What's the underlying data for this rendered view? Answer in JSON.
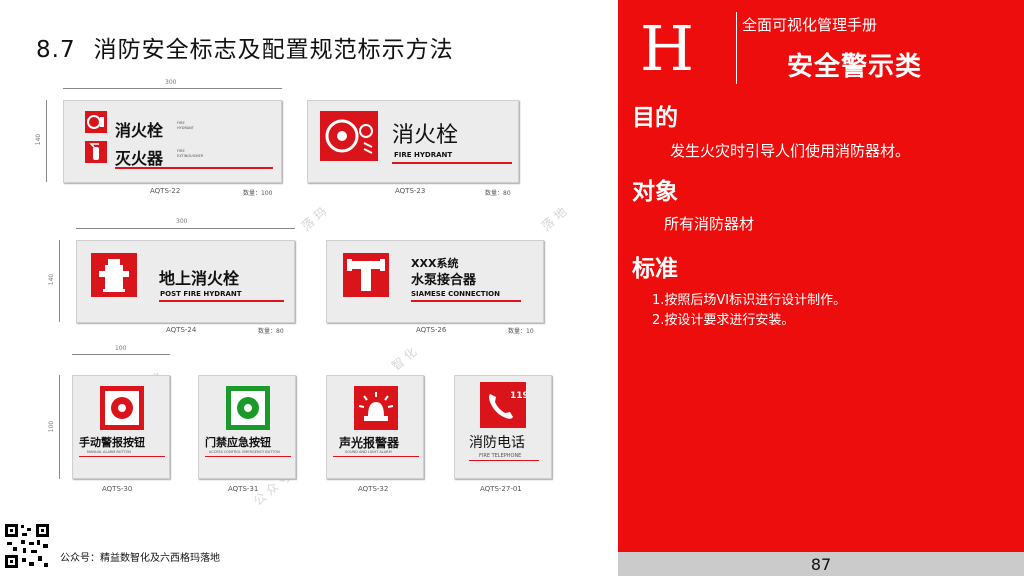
{
  "title": {
    "num": "8.7",
    "text": "消防安全标志及配置规范标示方法"
  },
  "signs": {
    "s22": {
      "cn1": "消火栓",
      "en1a": "FIRE",
      "en1b": "HYDRANT",
      "cn2": "灭火器",
      "en2a": "FIRE",
      "en2b": "EXTINGUISHER",
      "code": "AQTS-22",
      "qty": "数量：100",
      "w": "300",
      "h": "140"
    },
    "s23": {
      "cn": "消火栓",
      "en": "FIRE HYDRANT",
      "code": "AQTS-23",
      "qty": "数量：80"
    },
    "s24": {
      "cn": "地上消火栓",
      "en": "POST FIRE HYDRANT",
      "code": "AQTS-24",
      "qty": "数量：80",
      "w": "300",
      "h": "140"
    },
    "s26": {
      "cn1": "XXX系统",
      "cn2": "水泵接合器",
      "en": "SIAMESE CONNECTION",
      "code": "AQTS-26",
      "qty": "数量：10"
    },
    "s30": {
      "cn": "手动警报按钮",
      "en": "MANUAL ALARM BUTTON",
      "code": "AQTS-30",
      "w": "100",
      "h": "100"
    },
    "s31": {
      "cn": "门禁应急按钮",
      "en": "ACCESS CONTROL EMERGENCY BUTTON",
      "code": "AQTS-31"
    },
    "s32": {
      "cn": "声光报警器",
      "en": "SOUND AND LIGHT ALARM",
      "code": "AQTS-32"
    },
    "s27": {
      "cn": "消防电话",
      "en": "FIRE TELEPHONE",
      "code": "AQTS-27-01",
      "num": "119"
    }
  },
  "footer": "公众号：精益数智化及六西格玛落地",
  "right": {
    "letter": "H",
    "subtitle": "全面可视化管理手册",
    "main": "安全警示类",
    "purpose_h": "目的",
    "purpose_t": "发生火灾时引导人们使用消防器材。",
    "target_h": "对象",
    "target_t": "所有消防器材",
    "std_h": "标准",
    "std_1": "1.按照后场VI标识进行设计制作。",
    "std_2": "2.按设计要求进行安装。",
    "page": "87"
  },
  "colors": {
    "red": "#ee0d0d",
    "sign_red": "#d9141a",
    "green": "#1a9a2a"
  }
}
